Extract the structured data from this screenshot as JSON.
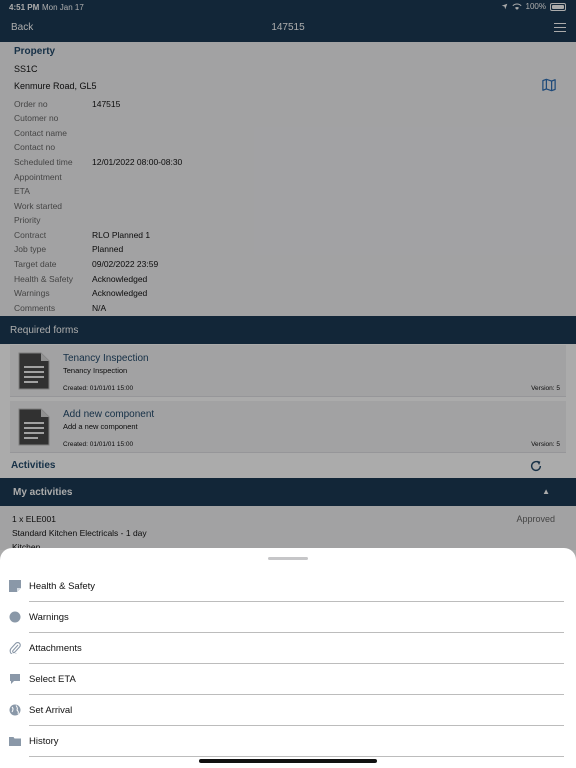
{
  "status_bar": {
    "time": "4:51 PM",
    "date": "Mon Jan 17",
    "battery": "100%"
  },
  "nav": {
    "back_label": "Back",
    "title": "147515"
  },
  "property": {
    "heading": "Property",
    "code": "SS1C",
    "address": "Kenmure Road, GL5",
    "fields": [
      {
        "label": "Order no",
        "value": "147515"
      },
      {
        "label": "Cutomer no",
        "value": ""
      },
      {
        "label": "Contact name",
        "value": ""
      },
      {
        "label": "Contact no",
        "value": ""
      },
      {
        "label": "Scheduled time",
        "value": "12/01/2022 08:00-08:30"
      },
      {
        "label": "Appointment",
        "value": ""
      },
      {
        "label": "ETA",
        "value": ""
      },
      {
        "label": "Work started",
        "value": ""
      },
      {
        "label": "Priority",
        "value": ""
      },
      {
        "label": "Contract",
        "value": "RLO Planned 1"
      },
      {
        "label": "Job type",
        "value": "Planned"
      },
      {
        "label": "Target date",
        "value": "09/02/2022 23:59"
      },
      {
        "label": "Health & Safety",
        "value": "Acknowledged"
      },
      {
        "label": "Warnings",
        "value": "Acknowledged"
      },
      {
        "label": "Comments",
        "value": "N/A"
      }
    ]
  },
  "required_forms": {
    "heading": "Required forms",
    "forms": [
      {
        "title": "Tenancy Inspection",
        "subtitle": "Tenancy Inspection",
        "created": "Created: 01/01/01 15:00",
        "version": "Version: 5"
      },
      {
        "title": "Add new component",
        "subtitle": "Add a new component",
        "created": "Created: 01/01/01 15:00",
        "version": "Version: 5"
      }
    ]
  },
  "activities": {
    "heading": "Activities",
    "my_activities_label": "My activities",
    "item": {
      "line1": "1 x ELE001",
      "line2": "Standard Kitchen Electricals - 1 day",
      "line3": "Kitchen",
      "status": "Approved"
    }
  },
  "sheet": {
    "items": [
      {
        "label": "Health & Safety",
        "icon": "note-icon"
      },
      {
        "label": "Warnings",
        "icon": "circle-icon"
      },
      {
        "label": "Attachments",
        "icon": "paperclip-icon"
      },
      {
        "label": "Select ETA",
        "icon": "chat-bubble-icon"
      },
      {
        "label": "Set Arrival",
        "icon": "globe-icon"
      },
      {
        "label": "History",
        "icon": "folder-icon"
      }
    ]
  },
  "colors": {
    "nav_bg": "#1b3a54",
    "accent": "#2d6fb5",
    "panel_bg": "#f2f2f4"
  }
}
